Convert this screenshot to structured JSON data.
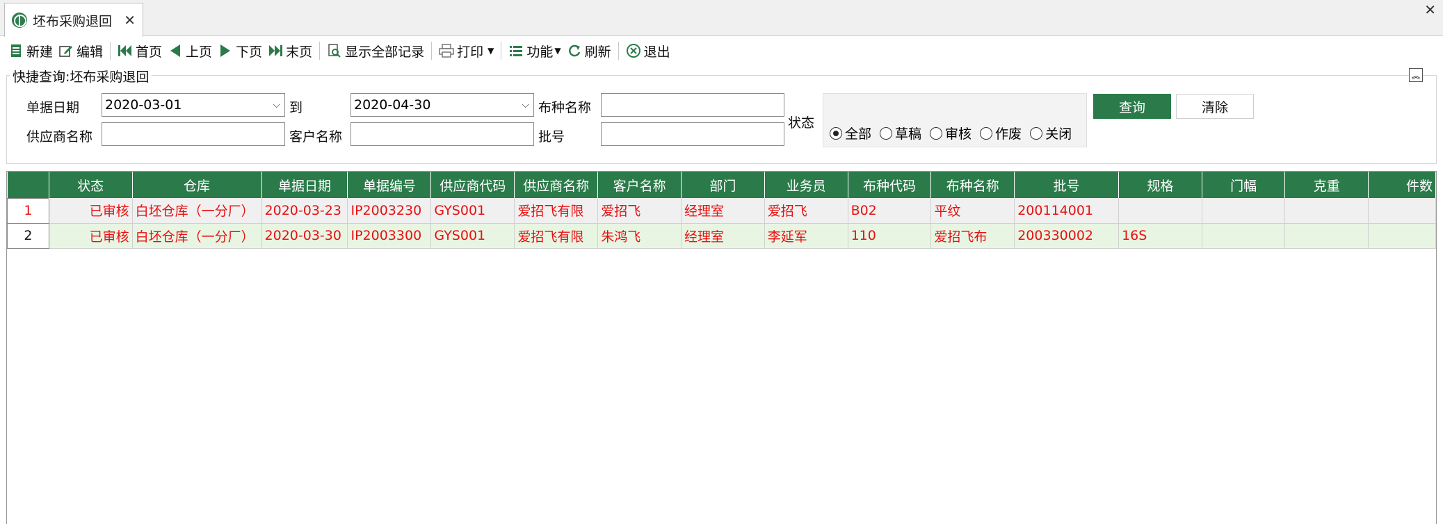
{
  "tab": {
    "title": "坯布采购退回"
  },
  "toolbar": {
    "new": "新建",
    "edit": "编辑",
    "first": "首页",
    "prev": "上页",
    "next": "下页",
    "last": "末页",
    "show_all": "显示全部记录",
    "print": "打印",
    "functions": "功能",
    "refresh": "刷新",
    "exit": "退出"
  },
  "query": {
    "title": "快捷查询:坯布采购退回",
    "date_label": "单据日期",
    "date_from": "2020-03-01",
    "to_label": "到",
    "date_to": "2020-04-30",
    "cloth_name_label": "布种名称",
    "cloth_name_value": "",
    "supplier_label": "供应商名称",
    "supplier_value": "",
    "customer_label": "客户名称",
    "customer_value": "",
    "batch_label": "批号",
    "batch_value": "",
    "status_label": "状态",
    "status_options": [
      "全部",
      "草稿",
      "审核",
      "作废",
      "关闭"
    ],
    "status_selected": "全部",
    "query_button": "查询",
    "clear_button": "清除"
  },
  "grid": {
    "columns": [
      "状态",
      "仓库",
      "单据日期",
      "单据编号",
      "供应商代码",
      "供应商名称",
      "客户名称",
      "部门",
      "业务员",
      "布种代码",
      "布种名称",
      "批号",
      "规格",
      "门幅",
      "克重",
      "件数"
    ],
    "rows": [
      {
        "no": "1",
        "cells": [
          "已审核",
          "白坯仓库（一分厂）",
          "2020-03-23",
          "IP2003230",
          "GYS001",
          "爱招飞有限",
          "爱招飞",
          "经理室",
          "爱招飞",
          "B02",
          "平纹",
          "200114001",
          "",
          "",
          "",
          ""
        ]
      },
      {
        "no": "2",
        "cells": [
          "已审核",
          "白坯仓库（一分厂）",
          "2020-03-30",
          "IP2003300",
          "GYS001",
          "爱招飞有限",
          "朱鸿飞",
          "经理室",
          "李延军",
          "110",
          "爱招飞布",
          "200330002",
          "16S",
          "",
          "",
          ""
        ]
      }
    ]
  },
  "colors": {
    "accent": "#2b7b4a",
    "text_red": "#e81010"
  }
}
